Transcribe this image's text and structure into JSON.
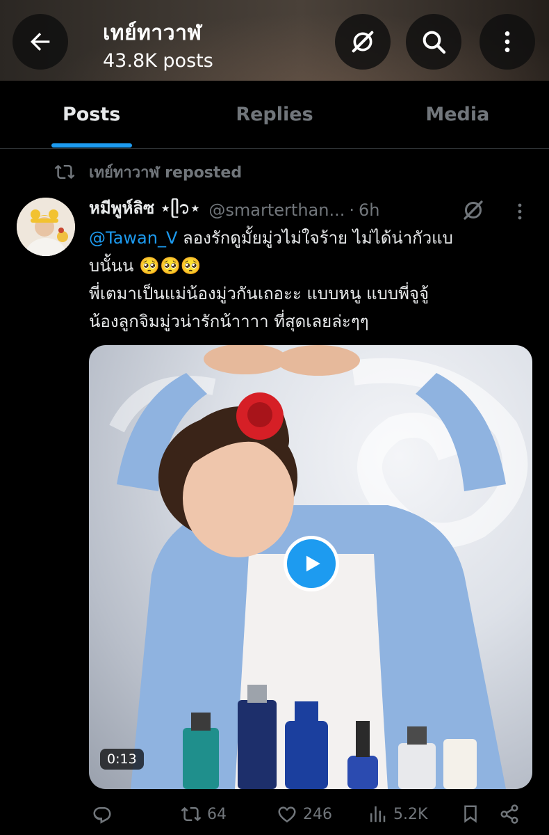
{
  "header": {
    "title": "เทย์ทาวาฬ",
    "subtitle": "43.8K posts"
  },
  "tabs": [
    {
      "label": "Posts",
      "active": true
    },
    {
      "label": "Replies",
      "active": false
    },
    {
      "label": "Media",
      "active": false
    }
  ],
  "repost": {
    "label": "เทย์ทาวาฬ reposted"
  },
  "tweet": {
    "display_name": "หมีพูห์ลิซ ⋆ᥫ᭡⋆",
    "handle": "@smarterthan...",
    "separator": "·",
    "time": "6h",
    "mention": "@Tawan_V",
    "line1_rest": " ลองรักดูมั้ยมู่วไม่ใจร้าย ไม่ได้น่ากัวแบ",
    "line2": "บนั้นน 🥺🥺🥺",
    "line3": "พี่เตมาเป็นแม่น้องมู่วกันเถอะะ แบบหนู แบบพี่จูจู้",
    "line4": "น้องลูกจิมมู่วน่ารักน้าาาา ที่สุดเลยล่ะๆๆ",
    "media": {
      "duration": "0:13"
    },
    "actions": {
      "reposts": "64",
      "likes": "246",
      "views": "5.2K"
    }
  },
  "colors": {
    "accent": "#1d9bf0",
    "muted": "#71767b",
    "text": "#e7e9ea",
    "background": "#000000"
  }
}
